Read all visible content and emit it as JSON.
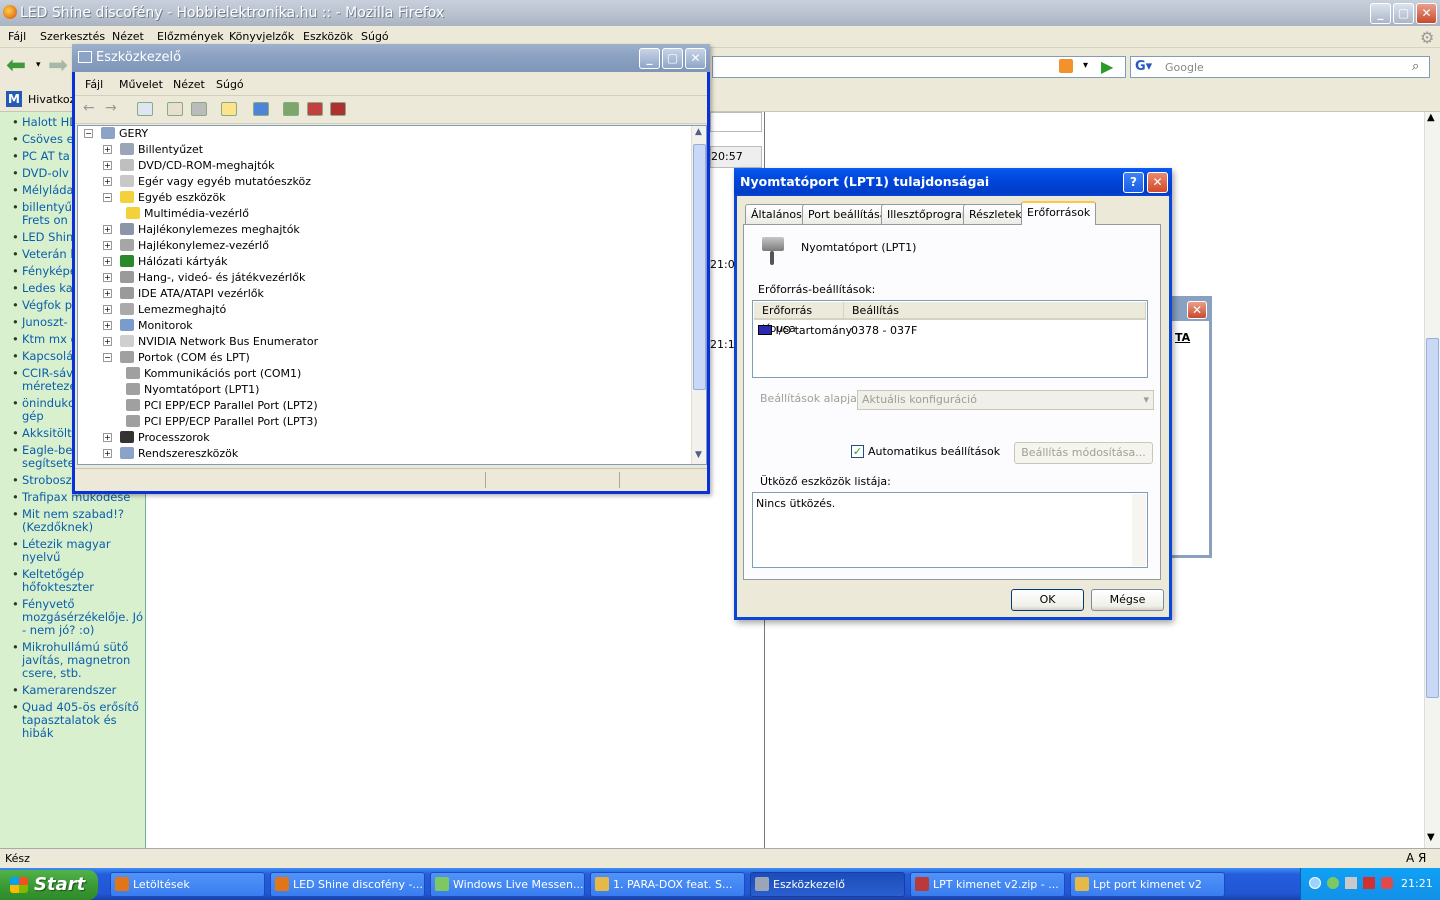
{
  "firefox": {
    "title": "LED Shine discofény - Hobbielektronika.hu :: - Mozilla Firefox",
    "menu": [
      "Fájl",
      "Szerkesztés",
      "Nézet",
      "Előzmények",
      "Könyvjelzők",
      "Eszközök",
      "Súgó"
    ],
    "search_placeholder": "Google",
    "bookmark": "Hivatkoz",
    "status": "Kész",
    "status_right": "A Я"
  },
  "sidebar": [
    "Halott HD javítás??",
    "Csöves e készítés",
    "PC AT ta",
    "DVD-olv lézer?",
    "Mélyláda",
    "billentyű átalakítás Frets on controller",
    "LED Shine",
    "Veterán hiba",
    "Fényképe",
    "Ledes ka",
    "Végfok p",
    "Junoszt-",
    "Ktm mx gyujtás",
    "Kapcsolá keresek",
    "CCIR-sáv használ méretezés",
    "önindukciós szikra gép",
    "Akksitöltő gond",
    "Eagle-ben jártasok segítsetek!",
    "Stroboszkóp",
    "Trafipax működése",
    "Mit nem szabad!? (Kezdőknek)",
    "Létezik magyar nyelvű",
    "Keltetőgép hőfokteszter",
    "Fényvető mozgásérzékelője. Jó - nem jó? :o)",
    "Mikrohullámú sütő javítás, magnetron csere, stb.",
    "Kamerarendszer",
    "Quad 405-ös erősítő tapasztalatok és hibák"
  ],
  "page_fragments": {
    "t1": "20:57",
    "t2": "21:0",
    "t3": "21:1",
    "bg_label": "TA"
  },
  "devmgr": {
    "title": "Eszközkezelő",
    "menu": [
      "Fájl",
      "Művelet",
      "Nézet",
      "Súgó"
    ],
    "root": "GERY",
    "nodes": [
      {
        "label": "Billentyűzet",
        "exp": "+",
        "level": 1
      },
      {
        "label": "DVD/CD-ROM-meghajtók",
        "exp": "+",
        "level": 1
      },
      {
        "label": "Egér vagy egyéb mutatóeszköz",
        "exp": "+",
        "level": 1
      },
      {
        "label": "Egyéb eszközök",
        "exp": "−",
        "level": 1
      },
      {
        "label": "Multimédia-vezérlő",
        "exp": "",
        "level": 2
      },
      {
        "label": "Hajlékonylemezes meghajtók",
        "exp": "+",
        "level": 1
      },
      {
        "label": "Hajlékonylemez-vezérlő",
        "exp": "+",
        "level": 1
      },
      {
        "label": "Hálózati kártyák",
        "exp": "+",
        "level": 1
      },
      {
        "label": "Hang-, videó- és játékvezérlők",
        "exp": "+",
        "level": 1
      },
      {
        "label": "IDE ATA/ATAPI vezérlők",
        "exp": "+",
        "level": 1
      },
      {
        "label": "Lemezmeghajtó",
        "exp": "+",
        "level": 1
      },
      {
        "label": "Monitorok",
        "exp": "+",
        "level": 1
      },
      {
        "label": "NVIDIA Network Bus Enumerator",
        "exp": "+",
        "level": 1
      },
      {
        "label": "Portok (COM és LPT)",
        "exp": "−",
        "level": 1
      },
      {
        "label": "Kommunikációs port (COM1)",
        "exp": "",
        "level": 2
      },
      {
        "label": "Nyomtatóport (LPT1)",
        "exp": "",
        "level": 2
      },
      {
        "label": "PCI EPP/ECP Parallel Port (LPT2)",
        "exp": "",
        "level": 2
      },
      {
        "label": "PCI EPP/ECP Parallel Port (LPT3)",
        "exp": "",
        "level": 2
      },
      {
        "label": "Processzorok",
        "exp": "+",
        "level": 1
      },
      {
        "label": "Rendszereszközök",
        "exp": "+",
        "level": 1
      }
    ]
  },
  "props": {
    "title": "Nyomtatóport (LPT1) tulajdonságai",
    "tabs": [
      "Általános",
      "Port beállítása",
      "Illesztőprogram",
      "Részletek",
      "Erőforrások"
    ],
    "device_name": "Nyomtatóport (LPT1)",
    "res_settings_label": "Erőforrás-beállítások:",
    "col_type": "Erőforrás típusa",
    "col_setting": "Beállítás",
    "row_type": "I/O tartomány",
    "row_value": "0378 - 037F",
    "based_on_label": "Beállítások alapja:",
    "based_on_value": "Aktuális konfiguráció",
    "auto_label": "Automatikus beállítások",
    "change_btn": "Beállítás módosítása...",
    "conflict_label": "Ütköző eszközök listája:",
    "conflict_text": "Nincs ütközés.",
    "ok": "OK",
    "cancel": "Mégse"
  },
  "taskbar": {
    "start": "Start",
    "tasks": [
      "Letöltések",
      "LED Shine discofény -...",
      "Windows Live Messen...",
      "1. PARA-DOX feat. S...",
      "Eszközkezelő",
      "LPT kimenet v2.zip - ...",
      "Lpt port kimenet v2"
    ],
    "clock": "21:21"
  }
}
